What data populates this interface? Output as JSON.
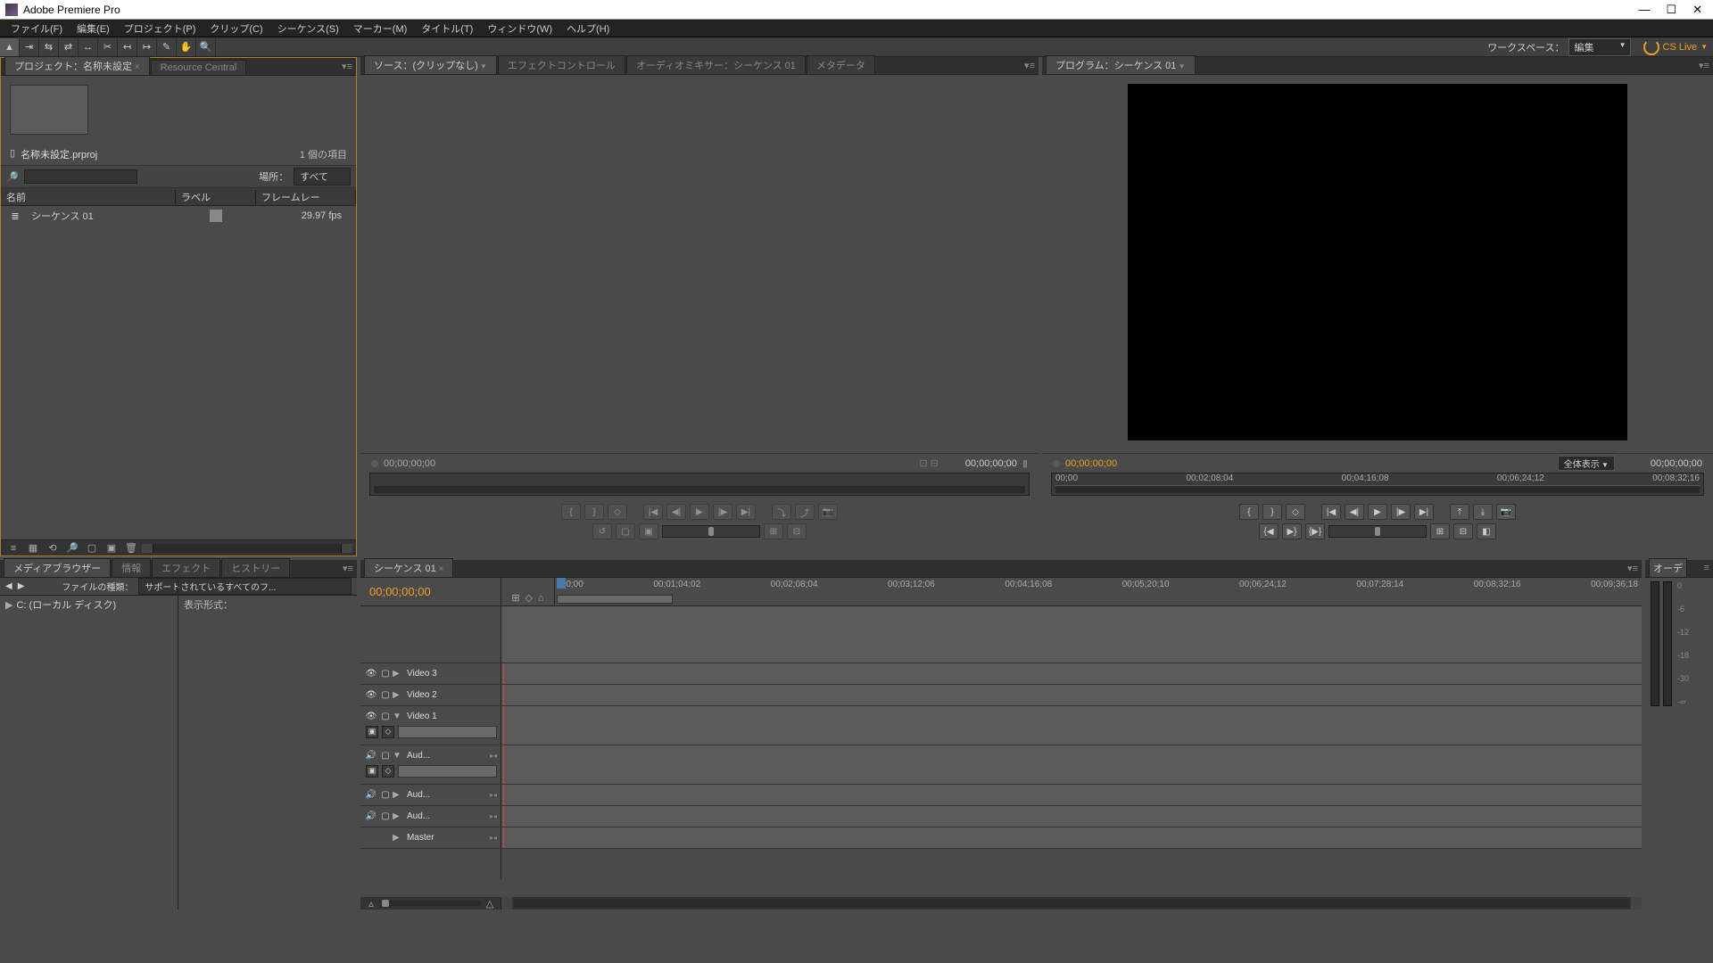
{
  "title": "Adobe Premiere Pro",
  "menu": [
    "ファイル(F)",
    "編集(E)",
    "プロジェクト(P)",
    "クリップ(C)",
    "シーケンス(S)",
    "マーカー(M)",
    "タイトル(T)",
    "ウィンドウ(W)",
    "ヘルプ(H)"
  ],
  "workspace": {
    "label": "ワークスペース：",
    "value": "編集"
  },
  "cslive": "CS Live",
  "project": {
    "tab": "プロジェクト：名称未設定",
    "tab2": "Resource Central",
    "file": "名称未設定.prproj",
    "count": "1 個の項目",
    "locLabel": "場所：",
    "locValue": "すべて",
    "cols": {
      "name": "名前",
      "label": "ラベル",
      "rate": "フレームレー"
    },
    "row": {
      "name": "シーケンス 01",
      "rate": "29.97 fps"
    }
  },
  "source": {
    "tab": "ソース：(クリップなし)",
    "tabs": [
      "エフェクトコントロール",
      "オーディオミキサー：シーケンス 01",
      "メタデータ"
    ],
    "tc1": "00;00;00;00",
    "tc2": "00;00;00;00"
  },
  "program": {
    "tab": "プログラム：シーケンス 01",
    "tc1": "00;00;00;00",
    "fit": "全体表示",
    "tc2": "00;00;00;00",
    "ticks": [
      "00;00",
      "00;02;08;04",
      "00;04;16;08",
      "00;06;24;12",
      "00;08;32;16"
    ]
  },
  "mediabrowser": {
    "tab": "メディアブラウザー",
    "tabs": [
      "情報",
      "エフェクト",
      "ヒストリー"
    ],
    "filterLabel": "ファイルの種類：",
    "filterValue": "サポートされているすべてのフ...",
    "drive": "C: (ローカル ディスク)",
    "dispLabel": "表示形式："
  },
  "timeline": {
    "tab": "シーケンス 01",
    "tc": "00;00;00;00",
    "ticks": [
      ";00;00",
      "00;01;04;02",
      "00;02;08;04",
      "00;03;12;06",
      "00;04;16;08",
      "00;05;20;10",
      "00;06;24;12",
      "00;07;28;14",
      "00;08;32;16",
      "00;09;36;18"
    ],
    "v3": "Video 3",
    "v2": "Video 2",
    "v1": "Video 1",
    "a1": "Aud...",
    "a2": "Aud...",
    "a3": "Aud...",
    "master": "Master"
  },
  "audiometer": {
    "tab": "オーデ",
    "ticks": [
      "0",
      "-6",
      "-12",
      "-18",
      "-30",
      "-∞"
    ]
  }
}
